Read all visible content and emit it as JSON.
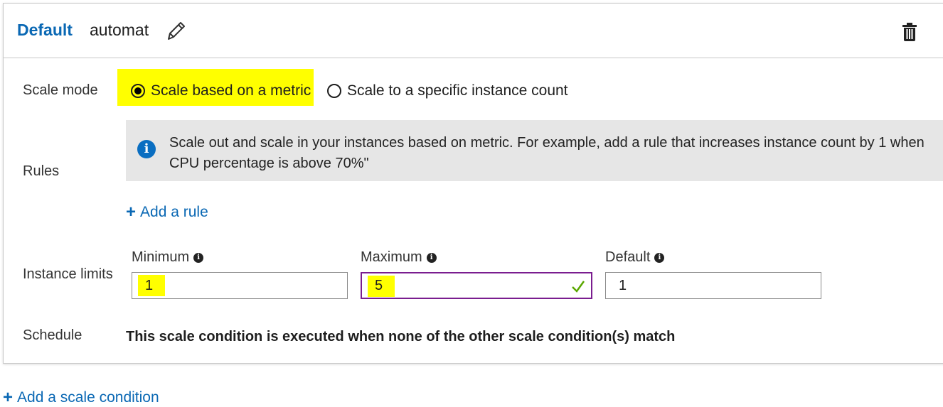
{
  "header": {
    "profile_type": "Default",
    "profile_name": "automat",
    "edit_icon": "pencil-icon",
    "delete_icon": "trash-icon"
  },
  "scale_mode": {
    "label": "Scale mode",
    "options": [
      {
        "label": "Scale based on a metric",
        "selected": true
      },
      {
        "label": "Scale to a specific instance count",
        "selected": false
      }
    ]
  },
  "rules": {
    "label": "Rules",
    "info_line1": "Scale out and scale in your instances based on metric. For example, add a rule that increases instance count by 1 when",
    "info_line2": "CPU percentage is above 70%\"",
    "add_rule": "Add a rule"
  },
  "instance_limits": {
    "label": "Instance limits",
    "minimum": {
      "label": "Minimum",
      "value": "1"
    },
    "maximum": {
      "label": "Maximum",
      "value": "5"
    },
    "default": {
      "label": "Default",
      "value": "1"
    }
  },
  "schedule": {
    "label": "Schedule",
    "text": "This scale condition is executed when none of the other scale condition(s) match"
  },
  "footer": {
    "add_condition": "Add a scale condition"
  },
  "colors": {
    "accent": "#0a68b4",
    "highlight": "#ffff00",
    "focus_border": "#7a1d8f",
    "check": "#5aa700"
  }
}
